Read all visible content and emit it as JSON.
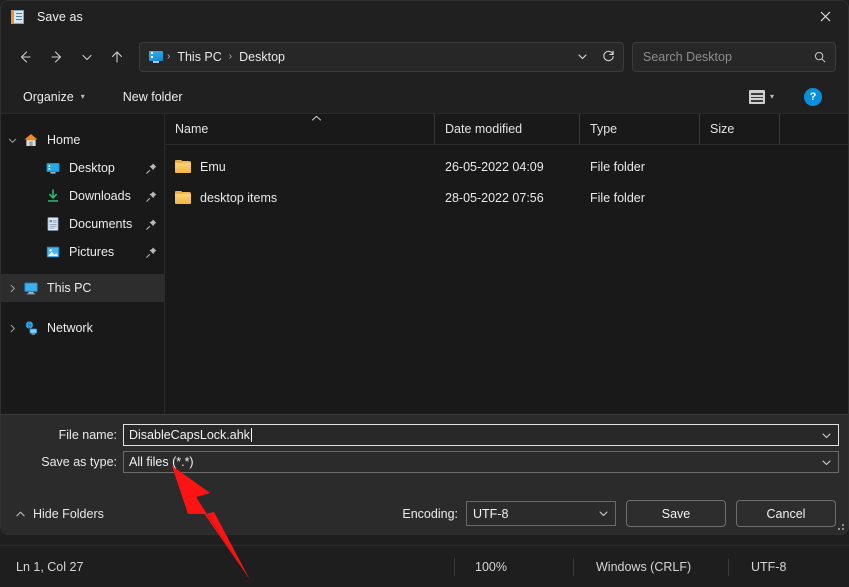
{
  "window": {
    "title": "Save as",
    "title_icon": "notepad-icon",
    "close_label": "✕"
  },
  "nav": {
    "back_icon": "arrow-left-icon",
    "forward_icon": "arrow-right-icon",
    "recent_icon": "chevron-down-icon",
    "up_icon": "arrow-up-icon",
    "refresh_icon": "refresh-icon",
    "address_dropdown_icon": "chevron-down-icon",
    "breadcrumb_icon": "this-pc-icon",
    "breadcrumbs": [
      "This PC",
      "Desktop"
    ],
    "separator": "›"
  },
  "search": {
    "placeholder": "Search Desktop",
    "icon": "search-icon"
  },
  "commandbar": {
    "organize_label": "Organize",
    "organize_caret": "▾",
    "new_folder_label": "New folder",
    "view_icon": "list-view-icon",
    "view_caret": "▾",
    "help_label": "?",
    "help_icon": "help-icon"
  },
  "navpane": {
    "items": [
      {
        "label": "Home",
        "icon": "home-icon",
        "twisty": "chevron-down",
        "indent": 0,
        "pinned": false,
        "selected": false
      },
      {
        "label": "Desktop",
        "icon": "desktop-icon",
        "twisty": "none",
        "indent": 1,
        "pinned": true,
        "selected": false
      },
      {
        "label": "Downloads",
        "icon": "downloads-icon",
        "twisty": "none",
        "indent": 1,
        "pinned": true,
        "selected": false
      },
      {
        "label": "Documents",
        "icon": "documents-icon",
        "twisty": "none",
        "indent": 1,
        "pinned": true,
        "selected": false
      },
      {
        "label": "Pictures",
        "icon": "pictures-icon",
        "twisty": "none",
        "indent": 1,
        "pinned": true,
        "selected": false
      },
      {
        "label": "This PC",
        "icon": "this-pc-icon",
        "twisty": "chevron-right",
        "indent": 0,
        "pinned": false,
        "selected": true
      },
      {
        "label": "Network",
        "icon": "network-icon",
        "twisty": "chevron-right",
        "indent": 0,
        "pinned": false,
        "selected": false
      }
    ]
  },
  "filelist": {
    "columns": [
      "Name",
      "Date modified",
      "Type",
      "Size"
    ],
    "sort_column": "Name",
    "sort_direction_icon": "chevron-up-icon",
    "rows": [
      {
        "name": "Emu",
        "icon": "folder-icon",
        "date": "26-05-2022 04:09",
        "type": "File folder",
        "size": ""
      },
      {
        "name": "desktop items",
        "icon": "folder-icon",
        "date": "28-05-2022 07:56",
        "type": "File folder",
        "size": ""
      }
    ]
  },
  "form": {
    "filename_label": "File name:",
    "filename_value": "DisableCapsLock.ahk",
    "filetype_label": "Save as type:",
    "filetype_value": "All files  (*.*)",
    "dropdown_icon": "chevron-down-icon",
    "hide_folders_label": "Hide Folders",
    "hide_folders_icon": "chevron-up-icon",
    "encoding_label": "Encoding:",
    "encoding_value": "UTF-8",
    "save_label": "Save",
    "cancel_label": "Cancel",
    "resize_grip_icon": "resize-grip-icon"
  },
  "statusbar": {
    "position": "Ln 1, Col 27",
    "zoom": "100%",
    "line_endings": "Windows (CRLF)",
    "encoding": "UTF-8"
  },
  "annotation": {
    "arrow_icon": "red-arrow-pointer",
    "color": "#fc1414",
    "points_to": "Save as type:"
  },
  "colors": {
    "dialog_bg": "#202020",
    "panel_bg": "#191919",
    "form_bg": "#2b2b2b",
    "accent_blue": "#0a8fdd",
    "folder_yellow": "#f2bb4e",
    "annotation_red": "#fc1414"
  }
}
